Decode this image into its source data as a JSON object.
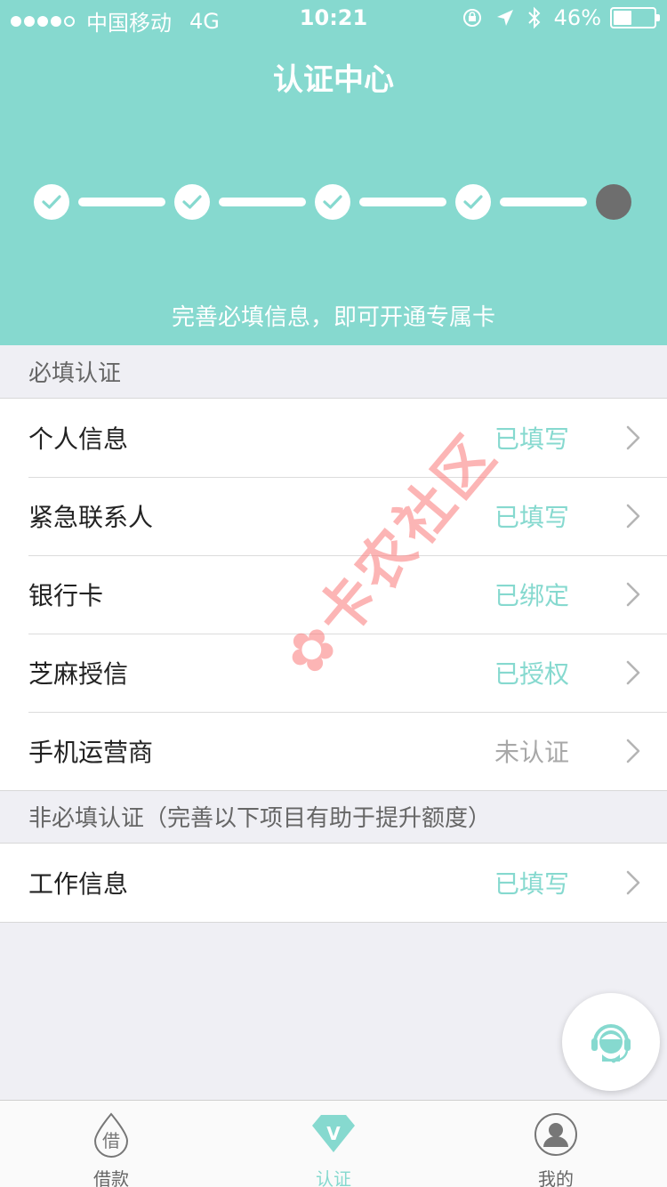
{
  "status_bar": {
    "carrier": "中国移动",
    "network": "4G",
    "time": "10:21",
    "battery_text": "46%",
    "battery_level": 0.46
  },
  "header": {
    "title": "认证中心",
    "subtitle": "完善必填信息，即可开通专属卡",
    "steps_completed": 4,
    "steps_total": 5
  },
  "required_section": {
    "title": "必填认证",
    "items": [
      {
        "label": "个人信息",
        "status": "已填写",
        "done": true
      },
      {
        "label": "紧急联系人",
        "status": "已填写",
        "done": true
      },
      {
        "label": "银行卡",
        "status": "已绑定",
        "done": true
      },
      {
        "label": "芝麻授信",
        "status": "已授权",
        "done": true
      },
      {
        "label": "手机运营商",
        "status": "未认证",
        "done": false
      }
    ]
  },
  "optional_section": {
    "title": "非必填认证（完善以下项目有助于提升额度）",
    "items": [
      {
        "label": "工作信息",
        "status": "已填写",
        "done": true
      }
    ]
  },
  "watermark": "卡农社区",
  "tabbar": {
    "tabs": [
      {
        "label": "借款",
        "icon": "loan-drop-icon",
        "icon_text": "借",
        "active": false
      },
      {
        "label": "认证",
        "icon": "verify-diamond-icon",
        "icon_text": "V",
        "active": true
      },
      {
        "label": "我的",
        "icon": "profile-icon",
        "active": false
      }
    ]
  },
  "colors": {
    "accent": "#86d9cf",
    "pending_step": "#6e6e6e",
    "background": "#efeff4",
    "watermark": "#fa7878"
  }
}
